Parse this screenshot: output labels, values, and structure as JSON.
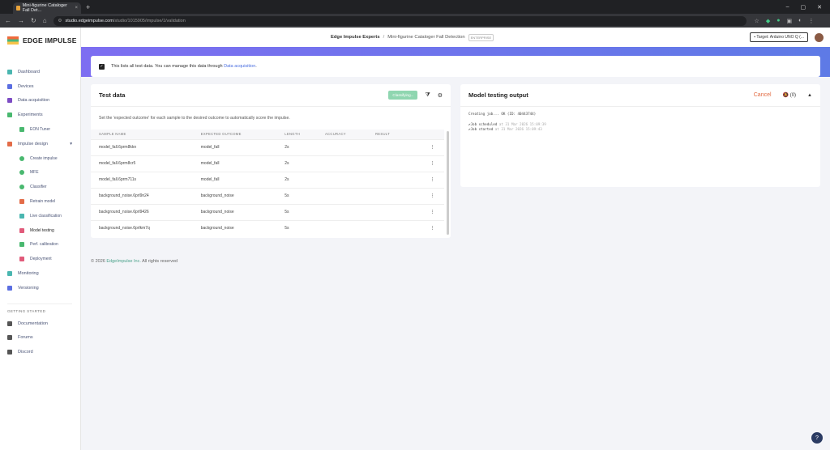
{
  "browser": {
    "tab_title": "Mini-figurine Cataloger Fall Det...",
    "url_host": "studio.edgeimpulse.com",
    "url_path": "/studio/1015905/impulse/1/validation"
  },
  "app": {
    "logo_text": "EDGE IMPULSE",
    "project_owner": "Edge Impulse Experts",
    "project_name": "Mini-figurine Cataloger Fall Detection",
    "project_tag": "ENTERPRISE",
    "target_label": "Target: Arduino UNO Q (..."
  },
  "sidebar": {
    "items": [
      {
        "label": "Dashboard",
        "icon": "monitor-icon",
        "color": "#4ab6b0",
        "sub": false
      },
      {
        "label": "Devices",
        "icon": "devices-icon",
        "color": "#5b6ee1",
        "sub": false
      },
      {
        "label": "Data acquisition",
        "icon": "database-icon",
        "color": "#7d4cc4",
        "sub": false
      },
      {
        "label": "Experiments",
        "icon": "experiments-icon",
        "color": "#49b86f",
        "sub": false
      },
      {
        "label": "EON Tuner",
        "icon": "tuner-icon",
        "color": "#49b86f",
        "sub": true
      },
      {
        "label": "Impulse design",
        "icon": "impulse-icon",
        "color": "#e36c48",
        "sub": false
      },
      {
        "label": "Create impulse",
        "icon": "dot-icon",
        "color": "#49b86f",
        "sub": true
      },
      {
        "label": "MFE",
        "icon": "dot-icon",
        "color": "#49b86f",
        "sub": true
      },
      {
        "label": "Classifier",
        "icon": "dot-icon",
        "color": "#49b86f",
        "sub": true
      },
      {
        "label": "Retrain model",
        "icon": "retrain-icon",
        "color": "#e36c48",
        "sub": true
      },
      {
        "label": "Live classification",
        "icon": "live-icon",
        "color": "#4ab6b0",
        "sub": true
      },
      {
        "label": "Model testing",
        "icon": "testing-icon",
        "color": "#e15a7a",
        "sub": true
      },
      {
        "label": "Perf. calibration",
        "icon": "calibration-icon",
        "color": "#49b86f",
        "sub": true
      },
      {
        "label": "Deployment",
        "icon": "deploy-icon",
        "color": "#e15a7a",
        "sub": true
      },
      {
        "label": "Monitoring",
        "icon": "monitoring-icon",
        "color": "#4ab6b0",
        "sub": false
      },
      {
        "label": "Versioning",
        "icon": "versioning-icon",
        "color": "#5b6ee1",
        "sub": false
      }
    ],
    "section_label": "GETTING STARTED",
    "help_items": [
      {
        "label": "Documentation",
        "icon": "docs-icon"
      },
      {
        "label": "Forums",
        "icon": "forums-icon"
      },
      {
        "label": "Discord",
        "icon": "discord-icon"
      }
    ]
  },
  "notice": {
    "text": "This lists all test data. You can manage this data through ",
    "link": "Data acquisition",
    "end": "."
  },
  "test_data": {
    "title": "Test data",
    "classify_label": "Classifying...",
    "description": "Set the 'expected outcome' for each sample to the desired outcome to automatically score the impulse.",
    "columns": [
      "SAMPLE NAME",
      "EXPECTED OUTCOME",
      "LENGTH",
      "ACCURACY",
      "RESULT"
    ],
    "rows": [
      [
        "model_fall.6prm8kkn",
        "model_fall",
        "2s",
        "",
        ""
      ],
      [
        "model_fall.6prm8cr5",
        "model_fall",
        "2s",
        "",
        ""
      ],
      [
        "model_fall.6prm711s",
        "model_fall",
        "2s",
        "",
        ""
      ],
      [
        "background_noise.6prl9n24",
        "background_noise",
        "5s",
        "",
        ""
      ],
      [
        "background_noise.6prl9426",
        "background_noise",
        "5s",
        "",
        ""
      ],
      [
        "background_noise.6prlkm7q",
        "background_noise",
        "5s",
        "",
        ""
      ]
    ]
  },
  "output": {
    "title": "Model testing output",
    "cancel_label": "Cancel",
    "notif_count": "(0)",
    "lines": [
      {
        "text": "Creating job... OK (ID: 40443744)",
        "dim": ""
      },
      {
        "text": "",
        "dim": ""
      },
      {
        "text": "Job scheduled",
        "dim": " at 31 Mar 2026 15:09:39"
      },
      {
        "text": "Job started",
        "dim": " at 31 Mar 2026 15:09:43"
      }
    ]
  },
  "footer": {
    "prefix": "© 2026 ",
    "company": "EdgeImpulse Inc.",
    "suffix": " All rights reserved"
  }
}
